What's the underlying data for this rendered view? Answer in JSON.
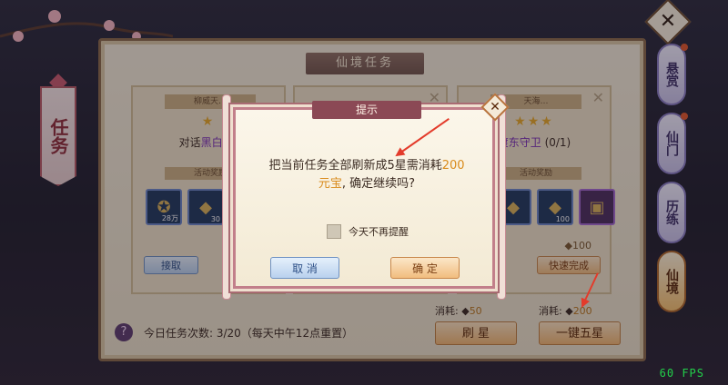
{
  "panel": {
    "title": "仙境任务",
    "cards": [
      {
        "ribbon": "柳威天…",
        "stars": "★",
        "task_prefix": "对话",
        "task_target": "黑白子",
        "task_suffix": "(",
        "reward_label": "活动奖励",
        "items": [
          {
            "qty": "28万"
          },
          {
            "qty": "30"
          }
        ],
        "button": "接取"
      },
      {
        "ribbon": "",
        "stars": "",
        "task_prefix": "",
        "task_target": "",
        "task_suffix": "",
        "reward_label": "",
        "items": [],
        "button": ""
      },
      {
        "ribbon": "天海…",
        "stars": "★★★",
        "task_prefix": "",
        "task_target": "渡东守卫",
        "task_suffix": " (0/1)",
        "reward_label": "活动奖励",
        "items": [
          {
            "qty": ""
          },
          {
            "qty": "100"
          },
          {
            "qty": ""
          }
        ],
        "small_reward": "100",
        "button": "快速完成"
      }
    ],
    "daily_label": "今日任务次数: 3/20（每天中午12点重置）",
    "cost_left_label": "消耗:",
    "cost_left_value": "50",
    "cost_right_label": "消耗:",
    "cost_right_value": "200",
    "refresh_button": "刷 星",
    "five_star_button": "一键五星"
  },
  "side_tabs": [
    {
      "label": "悬赏",
      "badge": true
    },
    {
      "label": "仙门",
      "badge": true
    },
    {
      "label": "历练",
      "badge": false
    },
    {
      "label": "仙境",
      "badge": false
    }
  ],
  "banner": {
    "label": "任务"
  },
  "dialog": {
    "title": "提示",
    "message_pre": "把当前任务全部刷新成5星需消耗",
    "message_num": "200",
    "message_unit": "元宝",
    "message_post": ", 确定继续吗?",
    "checkbox_label": "今天不再提醒",
    "cancel": "取 消",
    "confirm": "确 定"
  },
  "fps": "60 FPS",
  "colors": {
    "accent_orange": "#d98b1c",
    "dialog_border": "#c27f8a",
    "arrow_red": "#e33b2b"
  }
}
